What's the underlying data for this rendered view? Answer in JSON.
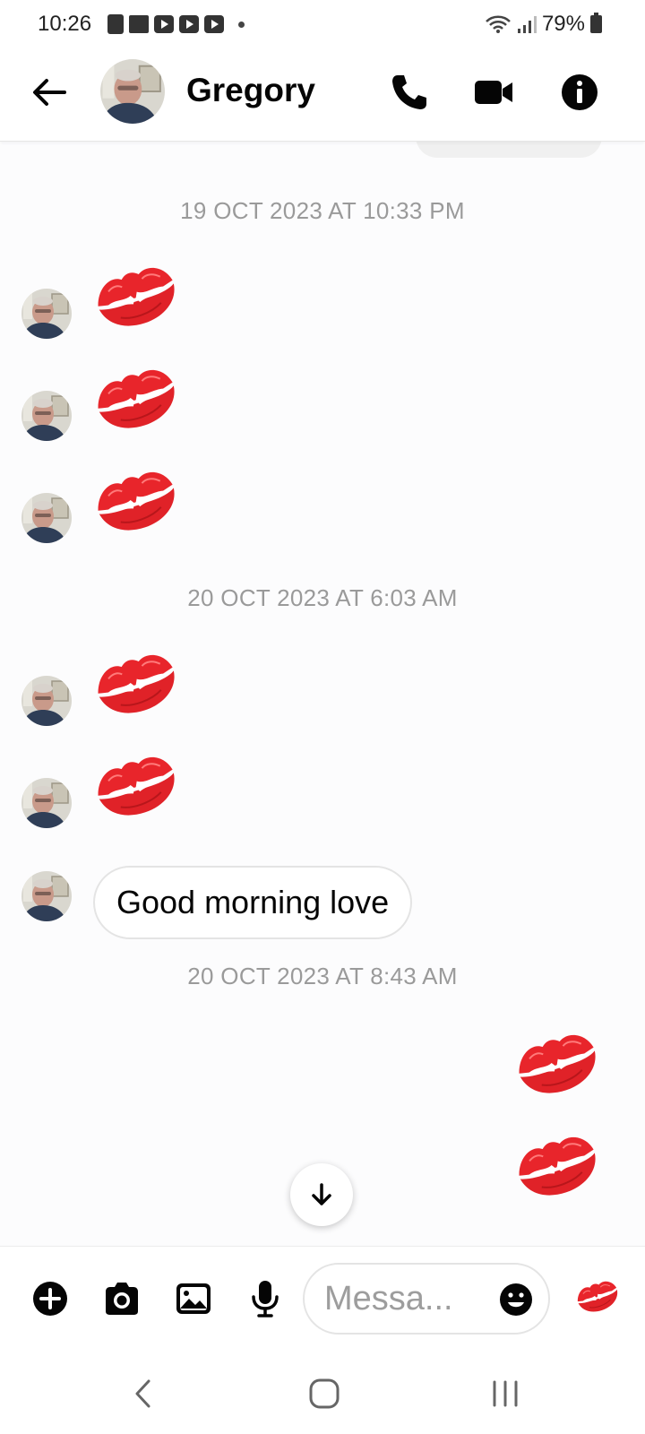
{
  "status_bar": {
    "time": "10:26",
    "battery": "79%",
    "notification_icons": [
      "shopping-bag-icon",
      "folder-icon",
      "youtube-icon",
      "youtube-icon",
      "youtube-icon"
    ],
    "right_icons": [
      "wifi-icon",
      "signal-icon",
      "battery-icon"
    ]
  },
  "header": {
    "back_icon": "arrow-left-icon",
    "contact_name": "Gregory",
    "actions": [
      "phone-icon",
      "video-camera-icon",
      "info-icon"
    ]
  },
  "colors": {
    "accent": "#0084ff",
    "lips": "#e8252b",
    "timestamp": "#9a9a9a"
  },
  "conversation": {
    "groups": [
      {
        "timestamp": "19 OCT 2023 AT 10:33 PM",
        "messages": [
          {
            "sender": "Gregory",
            "type": "emoji",
            "emoji": "💋"
          },
          {
            "sender": "Gregory",
            "type": "emoji",
            "emoji": "💋"
          },
          {
            "sender": "Gregory",
            "type": "emoji",
            "emoji": "💋"
          }
        ]
      },
      {
        "timestamp": "20 OCT 2023 AT 6:03 AM",
        "messages": [
          {
            "sender": "Gregory",
            "type": "emoji",
            "emoji": "💋"
          },
          {
            "sender": "Gregory",
            "type": "emoji",
            "emoji": "💋"
          },
          {
            "sender": "Gregory",
            "type": "text",
            "text": "Good morning love"
          }
        ]
      },
      {
        "timestamp": "20 OCT 2023 AT 8:43 AM",
        "messages": [
          {
            "sender": "me",
            "type": "emoji",
            "emoji": "💋"
          },
          {
            "sender": "me",
            "type": "emoji",
            "emoji": "💋"
          }
        ]
      }
    ]
  },
  "composer": {
    "placeholder": "Messa...",
    "left_actions": [
      "plus-icon",
      "camera-icon",
      "gallery-icon",
      "microphone-icon"
    ],
    "emoji_icon": "smiley-icon",
    "quick_reaction": "💋"
  },
  "nav_bar": [
    "back-icon",
    "home-icon",
    "recents-icon"
  ]
}
